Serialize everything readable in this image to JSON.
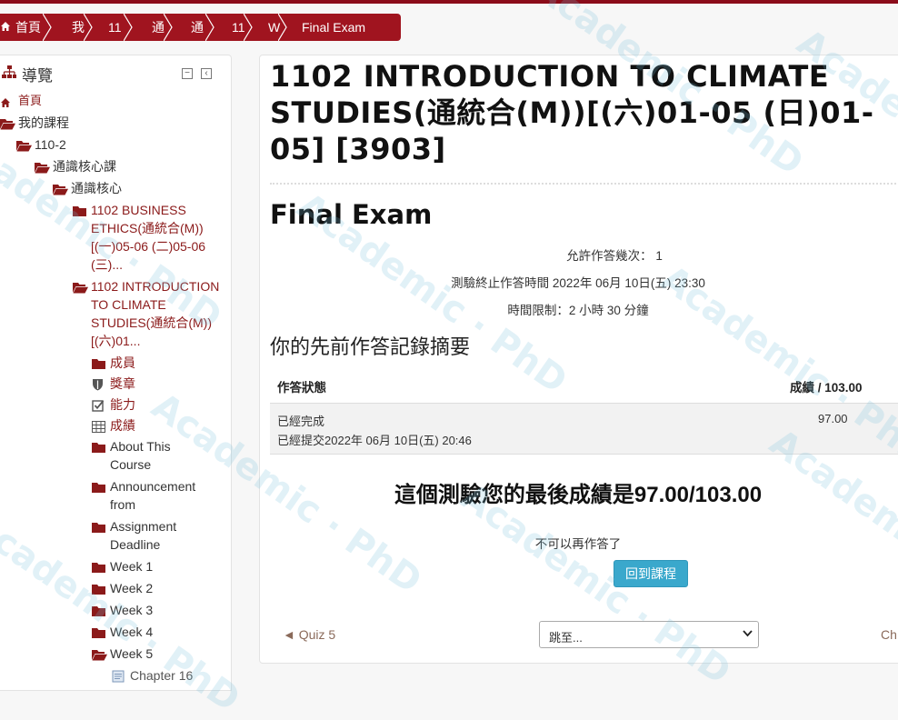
{
  "breadcrumb": {
    "items": [
      "首頁",
      "我",
      "11",
      "通",
      "通",
      "11",
      "W",
      "Final Exam"
    ]
  },
  "nav": {
    "title": "導覽",
    "items": [
      {
        "label": "首頁",
        "icon": "home-icon"
      },
      {
        "label": "我的課程",
        "icon": "folder-open-icon"
      },
      {
        "label": "110-2",
        "icon": "folder-open-icon"
      },
      {
        "label": "通識核心課",
        "icon": "folder-open-icon"
      },
      {
        "label": "通識核心",
        "icon": "folder-open-icon"
      },
      {
        "label": "1102 BUSINESS ETHICS(通統合(M))[(一)05-06 (二)05-06 (三)...",
        "icon": "folder-icon"
      },
      {
        "label": "1102 INTRODUCTION TO CLIMATE STUDIES(通統合(M))[(六)01...",
        "icon": "folder-open-icon"
      },
      {
        "label": "成員",
        "icon": "folder-icon"
      },
      {
        "label": "獎章",
        "icon": "shield-icon"
      },
      {
        "label": "能力",
        "icon": "checkbox-icon"
      },
      {
        "label": "成績",
        "icon": "table-icon"
      },
      {
        "label": "About This Course",
        "icon": "folder-icon"
      },
      {
        "label": "Announcement from",
        "icon": "folder-icon"
      },
      {
        "label": "Assignment Deadline",
        "icon": "folder-icon"
      },
      {
        "label": "Week 1",
        "icon": "folder-icon"
      },
      {
        "label": "Week 2",
        "icon": "folder-icon"
      },
      {
        "label": "Week 3",
        "icon": "folder-icon"
      },
      {
        "label": "Week 4",
        "icon": "folder-icon"
      },
      {
        "label": "Week 5",
        "icon": "folder-open-icon"
      },
      {
        "label": "Chapter 16",
        "icon": "page-icon"
      }
    ]
  },
  "main": {
    "course_title": "1102 INTRODUCTION TO CLIMATE STUDIES(通統合(M))[(六)01-05 (日)01-05] [3903]",
    "quiz_title": "Final Exam",
    "attempts_allowed": "允許作答幾次：  1",
    "close_time": "測驗終止作答時間 2022年 06月 10日(五) 23:30",
    "time_limit": "時間限制：2 小時 30 分鐘",
    "summary_heading": "你的先前作答記錄摘要",
    "table": {
      "col_status": "作答狀態",
      "col_grade": "成績 / 103.00",
      "row_status_1": "已經完成",
      "row_status_2": "已經提交2022年 06月 10日(五) 20:46",
      "row_grade": "97.00"
    },
    "final_grade": "這個測驗您的最後成績是97.00/103.00",
    "no_more_attempts": "不可以再作答了",
    "back_button": "回到課程",
    "prev_link": "◄ Quiz 5",
    "jump_select": "跳至...",
    "next_link": "Ch"
  },
  "watermark": "Academic · PhD",
  "colors": {
    "brand": "#a0141f",
    "button": "#3aa8cc"
  }
}
